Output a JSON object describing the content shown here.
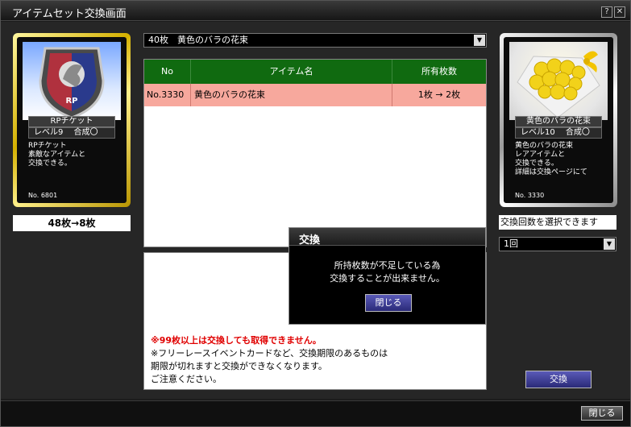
{
  "window": {
    "title": "アイテムセット交換画面",
    "help_label": "?",
    "close_label": "✕"
  },
  "left_card": {
    "name": "RPチケット",
    "level": "レベル9　 合成〇",
    "desc": [
      "RPチケット",
      "素敵なアイテムと",
      "交換できる。"
    ],
    "number": "No. 6801"
  },
  "left_count": "48枚→8枚",
  "item_select": {
    "value": "40枚　黄色のバラの花束",
    "arrow": "▼"
  },
  "table": {
    "headers": [
      "No",
      "アイテム名",
      "所有枚数"
    ],
    "rows": [
      {
        "no": "No.3330",
        "name": "黄色のバラの花束",
        "qty": "1枚 → 2枚"
      }
    ]
  },
  "notice": {
    "red": "※99枚以上は交換しても取得できません。",
    "lines": [
      "※フリーレースイベントカードなど、交換期限のあるものは",
      "期限が切れますと交換ができなくなります。",
      "ご注意ください。"
    ]
  },
  "right_card": {
    "name": "黄色のバラの花束",
    "level": "レベル10　 合成〇",
    "desc": [
      "黄色のバラの花束",
      "レアアイテムと",
      "交換できる。",
      "詳細は交換ページにて"
    ],
    "number": "No. 3330"
  },
  "select_count_label": "交換回数を選択できます",
  "count_select": {
    "value": "1回",
    "arrow": "▼"
  },
  "exchange_button": "交換",
  "footer_close_button": "閉じる",
  "dialog": {
    "title": "交換",
    "message": [
      "所持枚数が不足している為",
      "交換することが出来ません。"
    ],
    "close_button": "閉じる"
  },
  "colors": {
    "table_header": "#106a10",
    "row_highlight": "#f7a89d",
    "notice_red": "#e00000",
    "button_blue": "#2a2a78"
  }
}
